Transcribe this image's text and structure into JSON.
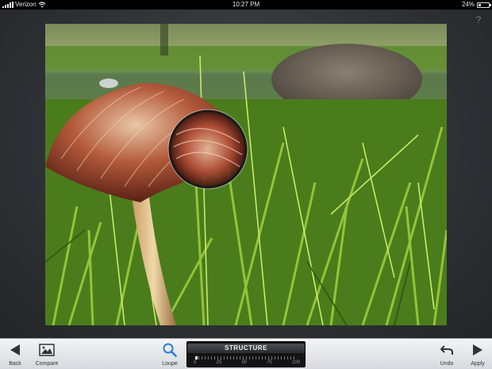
{
  "status_bar": {
    "carrier": "Verizon",
    "time": "10:27 PM",
    "battery_text": "24%",
    "battery_level": 0.24
  },
  "help": {
    "label": "?"
  },
  "toolbar": {
    "back_label": "Back",
    "compare_label": "Compare",
    "loupe_label": "Loupe",
    "undo_label": "Undo",
    "apply_label": "Apply"
  },
  "slider": {
    "title": "STRUCTURE",
    "value": 0,
    "scale": [
      "0",
      "25",
      "50",
      "75",
      "100"
    ]
  },
  "icons": {
    "back": "back-arrow-icon",
    "compare": "compare-image-icon",
    "loupe": "magnifier-icon",
    "undo": "undo-icon",
    "apply": "apply-arrow-icon",
    "wifi": "wifi-icon",
    "battery": "battery-icon"
  },
  "colors": {
    "toolbar_bg": "#dfe2e6",
    "canvas_bg": "#2e3135",
    "loupe_icon": "#2a7fd4"
  }
}
